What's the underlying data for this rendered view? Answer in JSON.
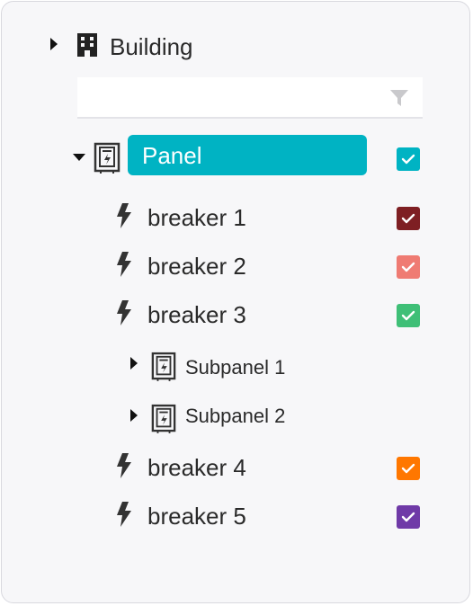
{
  "tree": {
    "root": {
      "label": "Building",
      "expanded": false,
      "icon": "building-icon"
    },
    "filter": {
      "value": "",
      "placeholder": "",
      "icon": "filter-icon"
    },
    "panel": {
      "label": "Panel",
      "expanded": true,
      "selected": true,
      "icon": "electrical-panel-icon",
      "color": "#00b3c3",
      "checked": true
    },
    "breakers": [
      {
        "label": "breaker 1",
        "color": "#7e1f23",
        "checked": true,
        "icon": "lightning-bolt-icon"
      },
      {
        "label": "breaker 2",
        "color": "#ef7b73",
        "checked": true,
        "icon": "lightning-bolt-icon"
      },
      {
        "label": "breaker 3",
        "color": "#3fbf77",
        "checked": true,
        "icon": "lightning-bolt-icon"
      },
      {
        "label": "breaker 4",
        "color": "#ff7700",
        "checked": true,
        "icon": "lightning-bolt-icon"
      },
      {
        "label": "breaker 5",
        "color": "#6f3aa7",
        "checked": true,
        "icon": "lightning-bolt-icon"
      }
    ],
    "subpanels": [
      {
        "label": "Subpanel 1",
        "expanded": false,
        "icon": "electrical-panel-icon"
      },
      {
        "label": "Subpanel 2",
        "expanded": false,
        "icon": "electrical-panel-icon"
      }
    ]
  }
}
